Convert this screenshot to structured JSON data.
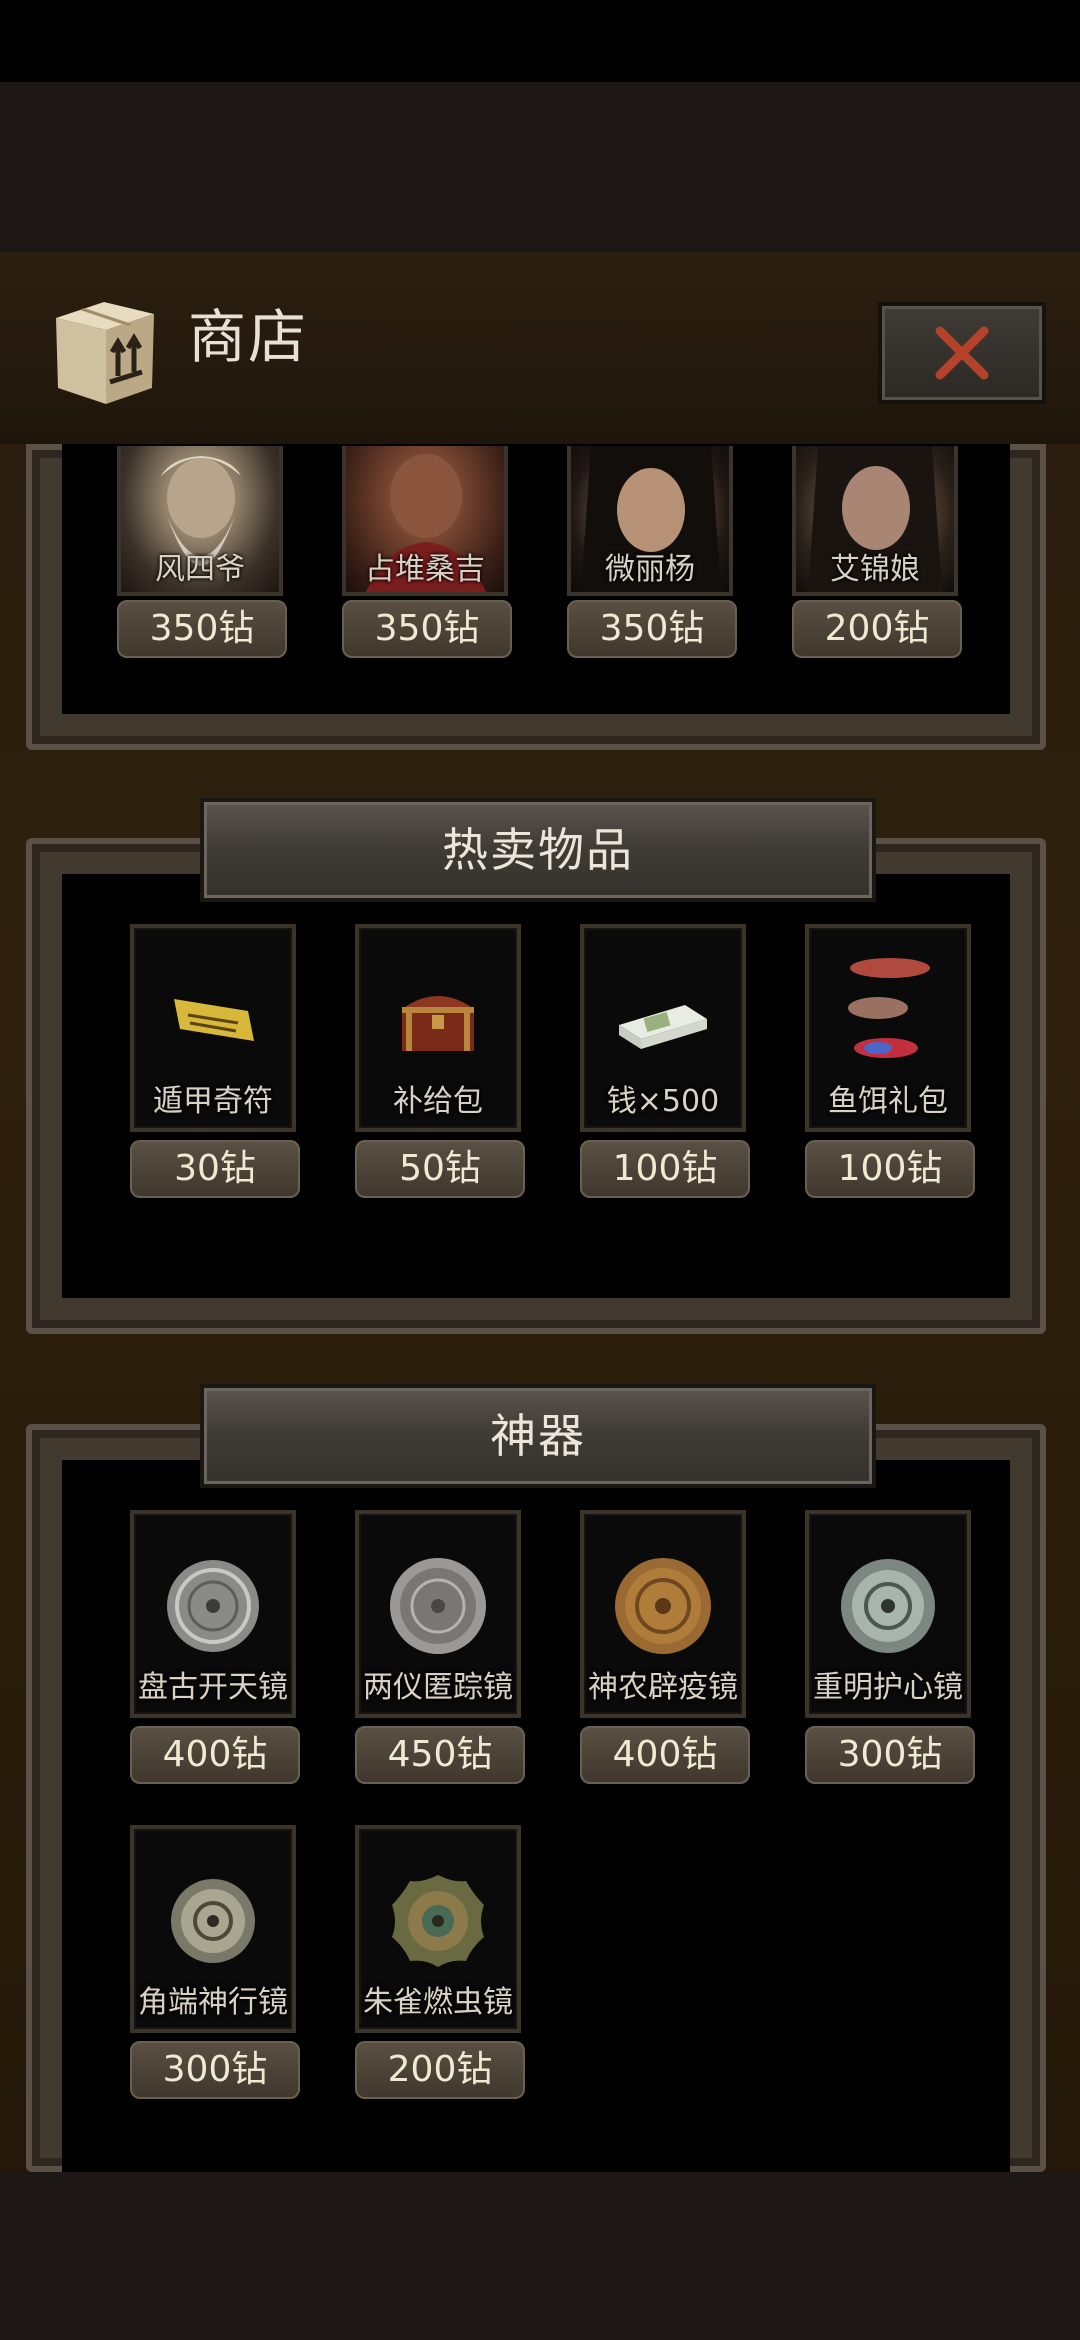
{
  "header": {
    "title": "商店",
    "icon": "cardboard-box-icon",
    "close_icon": "close-x-icon",
    "accent": "#b5432c"
  },
  "characters": [
    {
      "name": "风四爷",
      "price": "350钻"
    },
    {
      "name": "占堆桑吉",
      "price": "350钻"
    },
    {
      "name": "微丽杨",
      "price": "350钻"
    },
    {
      "name": "艾锦娘",
      "price": "200钻"
    }
  ],
  "hot": {
    "title": "热卖物品",
    "items": [
      {
        "name": "遁甲奇符",
        "price": "30钻",
        "icon": "talisman-icon"
      },
      {
        "name": "补给包",
        "price": "50钻",
        "icon": "chest-icon"
      },
      {
        "name": "钱×500",
        "price": "100钻",
        "icon": "money-stack-icon"
      },
      {
        "name": "鱼饵礼包",
        "price": "100钻",
        "icon": "fishing-lure-icon"
      }
    ]
  },
  "artifacts": {
    "title": "神器",
    "items": [
      {
        "name": "盘古开天镜",
        "price": "400钻",
        "icon": "bronze-mirror-icon"
      },
      {
        "name": "两仪匿踪镜",
        "price": "450钻",
        "icon": "bronze-mirror-icon"
      },
      {
        "name": "神农辟疫镜",
        "price": "400钻",
        "icon": "bronze-mirror-icon"
      },
      {
        "name": "重明护心镜",
        "price": "300钻",
        "icon": "bronze-mirror-icon"
      },
      {
        "name": "角端神行镜",
        "price": "300钻",
        "icon": "bronze-mirror-icon"
      },
      {
        "name": "朱雀燃虫镜",
        "price": "200钻",
        "icon": "bronze-mirror-icon"
      }
    ]
  }
}
